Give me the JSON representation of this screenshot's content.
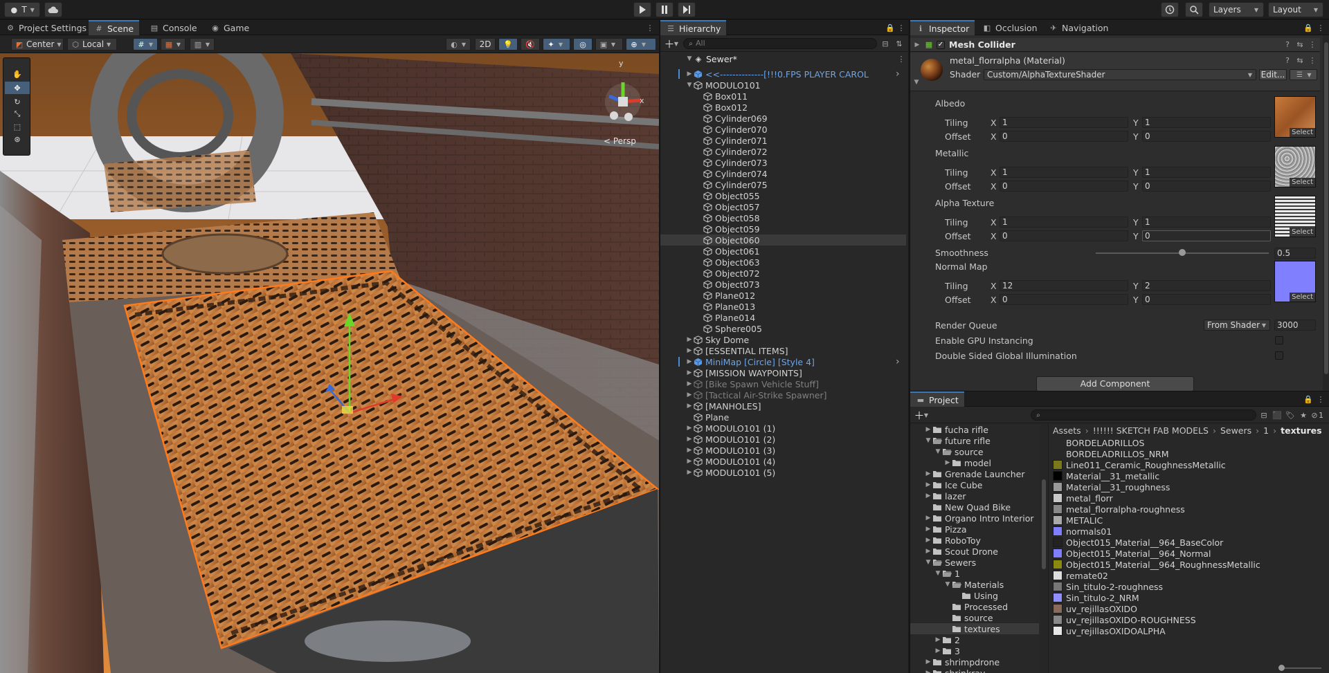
{
  "topbar": {
    "account": "T",
    "layers": "Layers",
    "layout": "Layout"
  },
  "scene_tabs": [
    "Project Settings",
    "Scene",
    "Console",
    "Game"
  ],
  "scene_toolbar": {
    "pivot": "Center",
    "space": "Local",
    "mode_2d": "2D",
    "persp": "< Persp",
    "gizmo_y": "y",
    "gizmo_x": "x"
  },
  "hierarchy": {
    "title": "Hierarchy",
    "search_placeholder": "All",
    "scene": "Sewer*",
    "rows": [
      {
        "label": "<<--------------[!!!0.FPS PLAYER CAROL",
        "indent": 1,
        "arrow": "▶",
        "style": "blue",
        "icon": "prefab",
        "right": true
      },
      {
        "label": "MODULO101",
        "indent": 1,
        "arrow": "▼",
        "style": "",
        "icon": "cube"
      },
      {
        "label": "Box011",
        "indent": 2,
        "arrow": "",
        "style": "",
        "icon": "cube"
      },
      {
        "label": "Box012",
        "indent": 2,
        "arrow": "",
        "style": "",
        "icon": "cube"
      },
      {
        "label": "Cylinder069",
        "indent": 2,
        "arrow": "",
        "style": "",
        "icon": "cube"
      },
      {
        "label": "Cylinder070",
        "indent": 2,
        "arrow": "",
        "style": "",
        "icon": "cube"
      },
      {
        "label": "Cylinder071",
        "indent": 2,
        "arrow": "",
        "style": "",
        "icon": "cube"
      },
      {
        "label": "Cylinder072",
        "indent": 2,
        "arrow": "",
        "style": "",
        "icon": "cube"
      },
      {
        "label": "Cylinder073",
        "indent": 2,
        "arrow": "",
        "style": "",
        "icon": "cube"
      },
      {
        "label": "Cylinder074",
        "indent": 2,
        "arrow": "",
        "style": "",
        "icon": "cube"
      },
      {
        "label": "Cylinder075",
        "indent": 2,
        "arrow": "",
        "style": "",
        "icon": "cube"
      },
      {
        "label": "Object055",
        "indent": 2,
        "arrow": "",
        "style": "",
        "icon": "cube"
      },
      {
        "label": "Object057",
        "indent": 2,
        "arrow": "",
        "style": "",
        "icon": "cube"
      },
      {
        "label": "Object058",
        "indent": 2,
        "arrow": "",
        "style": "",
        "icon": "cube"
      },
      {
        "label": "Object059",
        "indent": 2,
        "arrow": "",
        "style": "",
        "icon": "cube"
      },
      {
        "label": "Object060",
        "indent": 2,
        "arrow": "",
        "style": "sel",
        "icon": "cube"
      },
      {
        "label": "Object061",
        "indent": 2,
        "arrow": "",
        "style": "",
        "icon": "cube"
      },
      {
        "label": "Object063",
        "indent": 2,
        "arrow": "",
        "style": "",
        "icon": "cube"
      },
      {
        "label": "Object072",
        "indent": 2,
        "arrow": "",
        "style": "",
        "icon": "cube"
      },
      {
        "label": "Object073",
        "indent": 2,
        "arrow": "",
        "style": "",
        "icon": "cube"
      },
      {
        "label": "Plane012",
        "indent": 2,
        "arrow": "",
        "style": "",
        "icon": "cube"
      },
      {
        "label": "Plane013",
        "indent": 2,
        "arrow": "",
        "style": "",
        "icon": "cube"
      },
      {
        "label": "Plane014",
        "indent": 2,
        "arrow": "",
        "style": "",
        "icon": "cube"
      },
      {
        "label": "Sphere005",
        "indent": 2,
        "arrow": "",
        "style": "",
        "icon": "cube"
      },
      {
        "label": "Sky Dome",
        "indent": 1,
        "arrow": "▶",
        "style": "",
        "icon": "cube"
      },
      {
        "label": "[ESSENTIAL ITEMS]",
        "indent": 1,
        "arrow": "▶",
        "style": "",
        "icon": "cube"
      },
      {
        "label": "MiniMap [Circle] [Style 4]",
        "indent": 1,
        "arrow": "▶",
        "style": "blue",
        "icon": "prefab",
        "right": true
      },
      {
        "label": "[MISSION WAYPOINTS]",
        "indent": 1,
        "arrow": "▶",
        "style": "",
        "icon": "cube"
      },
      {
        "label": "[Bike Spawn Vehicle Stuff]",
        "indent": 1,
        "arrow": "▶",
        "style": "dim",
        "icon": "cube"
      },
      {
        "label": "[Tactical Air-Strike Spawner]",
        "indent": 1,
        "arrow": "▶",
        "style": "dim",
        "icon": "cube"
      },
      {
        "label": "[MANHOLES]",
        "indent": 1,
        "arrow": "▶",
        "style": "",
        "icon": "cube"
      },
      {
        "label": "Plane",
        "indent": 1,
        "arrow": "",
        "style": "",
        "icon": "cube"
      },
      {
        "label": "MODULO101 (1)",
        "indent": 1,
        "arrow": "▶",
        "style": "",
        "icon": "cube"
      },
      {
        "label": "MODULO101 (2)",
        "indent": 1,
        "arrow": "▶",
        "style": "",
        "icon": "cube"
      },
      {
        "label": "MODULO101 (3)",
        "indent": 1,
        "arrow": "▶",
        "style": "",
        "icon": "cube"
      },
      {
        "label": "MODULO101 (4)",
        "indent": 1,
        "arrow": "▶",
        "style": "",
        "icon": "cube"
      },
      {
        "label": "MODULO101 (5)",
        "indent": 1,
        "arrow": "▶",
        "style": "",
        "icon": "cube"
      }
    ]
  },
  "inspector": {
    "tabs": [
      "Inspector",
      "Occlusion",
      "Navigation"
    ],
    "component": "Mesh Collider",
    "material_name": "metal_florralpha (Material)",
    "shader_label": "Shader",
    "shader_value": "Custom/AlphaTextureShader",
    "edit_label": "Edit...",
    "albedo": "Albedo",
    "metallic": "Metallic",
    "alpha_texture": "Alpha Texture",
    "smoothness": "Smoothness",
    "smoothness_value": "0.5",
    "normal_map": "Normal Map",
    "tiling": "Tiling",
    "offset": "Offset",
    "x": "X",
    "y": "Y",
    "select": "Select",
    "albedo_tiling": [
      "1",
      "1"
    ],
    "albedo_offset": [
      "0",
      "0"
    ],
    "metallic_tiling": [
      "1",
      "1"
    ],
    "metallic_offset": [
      "0",
      "0"
    ],
    "alpha_tiling": [
      "1",
      "1"
    ],
    "alpha_offset": [
      "0",
      "0"
    ],
    "normal_tiling": [
      "12",
      "2"
    ],
    "normal_offset": [
      "0",
      "0"
    ],
    "render_queue": "Render Queue",
    "render_queue_mode": "From Shader",
    "render_queue_value": "3000",
    "gpu_instancing": "Enable GPU Instancing",
    "double_sided": "Double Sided Global Illumination",
    "add_component": "Add Component"
  },
  "project": {
    "title": "Project",
    "hidden_count": "1",
    "breadcrumb": [
      "Assets",
      "!!!!!! SKETCH FAB MODELS",
      "Sewers",
      "1",
      "textures"
    ],
    "folders": [
      {
        "label": "fucha rifle",
        "indent": 1,
        "arrow": "▶",
        "open": false
      },
      {
        "label": "future rifle",
        "indent": 1,
        "arrow": "▼",
        "open": true
      },
      {
        "label": "source",
        "indent": 2,
        "arrow": "▼",
        "open": true
      },
      {
        "label": "model",
        "indent": 3,
        "arrow": "▶",
        "open": false
      },
      {
        "label": "Grenade Launcher",
        "indent": 1,
        "arrow": "▶",
        "open": false
      },
      {
        "label": "Ice Cube",
        "indent": 1,
        "arrow": "▶",
        "open": false
      },
      {
        "label": "lazer",
        "indent": 1,
        "arrow": "▶",
        "open": false
      },
      {
        "label": "New Quad Bike",
        "indent": 1,
        "arrow": "",
        "open": false
      },
      {
        "label": "Organo Intro Interior",
        "indent": 1,
        "arrow": "▶",
        "open": false
      },
      {
        "label": "Pizza",
        "indent": 1,
        "arrow": "▶",
        "open": false
      },
      {
        "label": "RoboToy",
        "indent": 1,
        "arrow": "▶",
        "open": false
      },
      {
        "label": "Scout Drone",
        "indent": 1,
        "arrow": "▶",
        "open": false
      },
      {
        "label": "Sewers",
        "indent": 1,
        "arrow": "▼",
        "open": true
      },
      {
        "label": "1",
        "indent": 2,
        "arrow": "▼",
        "open": true
      },
      {
        "label": "Materials",
        "indent": 3,
        "arrow": "▼",
        "open": true
      },
      {
        "label": "Using",
        "indent": 4,
        "arrow": "",
        "open": false
      },
      {
        "label": "Processed",
        "indent": 3,
        "arrow": "",
        "open": false
      },
      {
        "label": "source",
        "indent": 3,
        "arrow": "",
        "open": false
      },
      {
        "label": "textures",
        "indent": 3,
        "arrow": "",
        "open": false,
        "sel": true
      },
      {
        "label": "2",
        "indent": 2,
        "arrow": "▶",
        "open": false
      },
      {
        "label": "3",
        "indent": 2,
        "arrow": "▶",
        "open": false
      },
      {
        "label": "shrimpdrone",
        "indent": 1,
        "arrow": "▶",
        "open": false
      },
      {
        "label": "shrinkray",
        "indent": 1,
        "arrow": "▶",
        "open": false
      }
    ],
    "assets": [
      {
        "label": "BORDELADRILLOS",
        "color": ""
      },
      {
        "label": "BORDELADRILLOS_NRM",
        "color": ""
      },
      {
        "label": "Line011_Ceramic_RoughnessMetallic",
        "color": "#7a7a1a"
      },
      {
        "label": "Material__31_metallic",
        "color": "#000000"
      },
      {
        "label": "Material__31_roughness",
        "color": "#9a9a9a"
      },
      {
        "label": "metal_florr",
        "color": "#c8c8c8"
      },
      {
        "label": "metal_florralpha-roughness",
        "color": "#888888"
      },
      {
        "label": "METALIC",
        "color": "#aaaaaa"
      },
      {
        "label": "normals01",
        "color": "#8080ff"
      },
      {
        "label": "Object015_Material__964_BaseColor",
        "color": "#222222"
      },
      {
        "label": "Object015_Material__964_Normal",
        "color": "#8080ff"
      },
      {
        "label": "Object015_Material__964_RoughnessMetallic",
        "color": "#8a8a10"
      },
      {
        "label": "remate02",
        "color": "#dddddd"
      },
      {
        "label": "Sin_titulo-2-roughness",
        "color": "#777777"
      },
      {
        "label": "Sin_titulo-2_NRM",
        "color": "#8f8fff"
      },
      {
        "label": "uv_rejillasOXIDO",
        "color": "#8a6a5a"
      },
      {
        "label": "uv_rejillasOXIDO-ROUGHNESS",
        "color": "#888888"
      },
      {
        "label": "uv_rejillasOXIDOALPHA",
        "color": "#e6e6e6"
      }
    ]
  },
  "colors": {
    "accent": "#3a79bb",
    "selection_orange": "#ff7a1a",
    "prefab_blue": "#6aa5ee"
  }
}
